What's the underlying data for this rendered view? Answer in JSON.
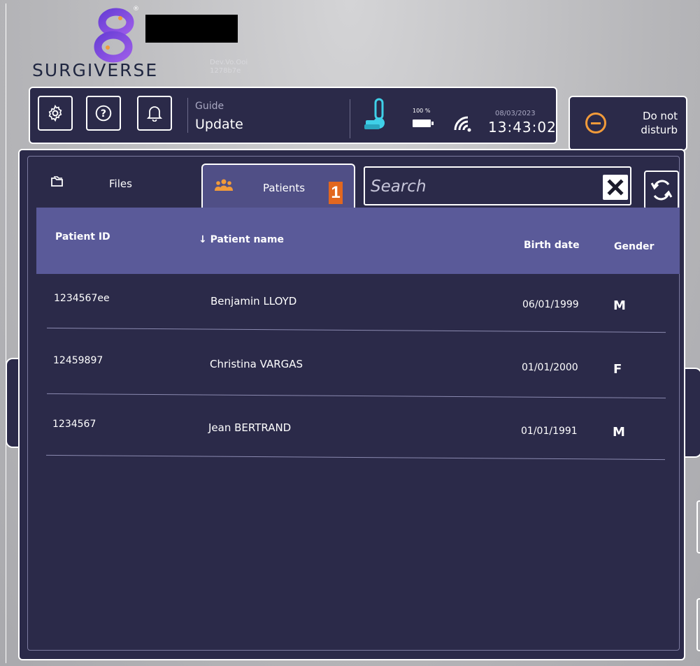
{
  "brand": {
    "name": "SURGIVERSE",
    "registered": "®",
    "build_line1": "Dev.Vo.Ooi",
    "build_line2": "1278b7e"
  },
  "toolbar": {
    "guide_label": "Guide",
    "guide_value": "Update",
    "battery_percent": "100 %",
    "date": "08/03/2023",
    "time": "13:43:02"
  },
  "dnd": {
    "label_line1": "Do not",
    "label_line2": "disturb"
  },
  "tabs": [
    {
      "label": "Files",
      "icon": "folder-icon",
      "active": false
    },
    {
      "label": "Patients",
      "icon": "users-icon",
      "active": true,
      "badge": "1"
    }
  ],
  "search": {
    "placeholder": "Search",
    "value": ""
  },
  "table": {
    "columns": [
      "Patient ID",
      "↓ Patient name",
      "Birth date",
      "Gender"
    ],
    "rows": [
      {
        "id": "1234567ee",
        "name": "Benjamin LLOYD",
        "birth_date": "06/01/1999",
        "gender": "M"
      },
      {
        "id": "12459897",
        "name": "Christina VARGAS",
        "birth_date": "01/01/2000",
        "gender": "F"
      },
      {
        "id": "1234567",
        "name": "Jean BERTRAND",
        "birth_date": "01/01/1991",
        "gender": "M"
      }
    ]
  },
  "colors": {
    "panel": "#2b2a49",
    "header": "#5a5a99",
    "accent": "#f29b3a",
    "badge": "#e2671f",
    "thermo": "#3fd0e8"
  }
}
